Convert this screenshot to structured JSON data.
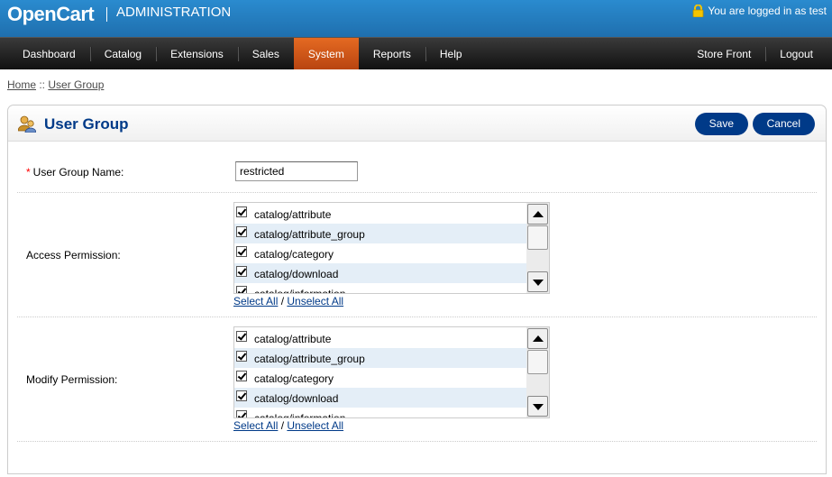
{
  "header": {
    "brand": "OpenCart",
    "subtitle": "ADMINISTRATION",
    "logged_in": "You are logged in as test"
  },
  "menu": {
    "left": [
      "Dashboard",
      "Catalog",
      "Extensions",
      "Sales",
      "System",
      "Reports",
      "Help"
    ],
    "active": "System",
    "right": [
      "Store Front",
      "Logout"
    ]
  },
  "breadcrumb": {
    "home": "Home",
    "separator": " :: ",
    "current": "User Group"
  },
  "box": {
    "title": "User Group",
    "save_label": "Save",
    "cancel_label": "Cancel"
  },
  "form": {
    "name_required": "*",
    "name_label": "User Group Name:",
    "name_value": "restricted",
    "access_label": "Access Permission:",
    "modify_label": "Modify Permission:",
    "access_items": [
      "catalog/attribute",
      "catalog/attribute_group",
      "catalog/category",
      "catalog/download",
      "catalog/information"
    ],
    "modify_items": [
      "catalog/attribute",
      "catalog/attribute_group",
      "catalog/category",
      "catalog/download",
      "catalog/information"
    ],
    "select_all": "Select All",
    "links_sep": " / ",
    "unselect_all": "Unselect All"
  },
  "colors": {
    "header_blue": "#1f6fae",
    "menu_active": "#d85a1a",
    "button_blue": "#003a88",
    "row_alt": "#e4eef7"
  }
}
